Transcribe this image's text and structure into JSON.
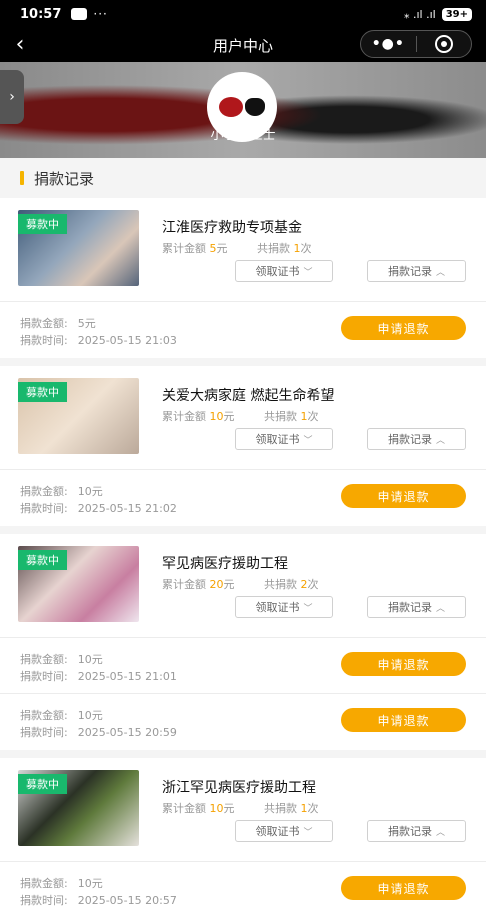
{
  "status_bar": {
    "time": "10:57",
    "dots": "···",
    "signal": "⁎ .ıl .ıl",
    "battery": "39+"
  },
  "nav": {
    "back_glyph": "‹",
    "title": "用户中心",
    "more_glyph": "•●•"
  },
  "profile": {
    "side_tab_glyph": "›",
    "username": "小小怪上士"
  },
  "section": {
    "title": "捐款记录"
  },
  "labels": {
    "status_badge": "募款中",
    "total_amount": "累计金额",
    "total_count": "共捐款",
    "cert_button": "领取证书",
    "record_button": "捐款记录",
    "donation_amount": "捐款金额:",
    "donation_time": "捐款时间:",
    "refund_button": "申请退款"
  },
  "projects": [
    {
      "title": "江淮医疗救助专项基金",
      "total": "5",
      "unit": "元",
      "count": "1",
      "count_unit": "次",
      "records": [
        {
          "amount": "5元",
          "time": "2025-05-15 21:03"
        }
      ]
    },
    {
      "title": "关爱大病家庭 燃起生命希望",
      "total": "10",
      "unit": "元",
      "count": "1",
      "count_unit": "次",
      "records": [
        {
          "amount": "10元",
          "time": "2025-05-15 21:02"
        }
      ]
    },
    {
      "title": "罕见病医疗援助工程",
      "total": "20",
      "unit": "元",
      "count": "2",
      "count_unit": "次",
      "records": [
        {
          "amount": "10元",
          "time": "2025-05-15 21:01"
        },
        {
          "amount": "10元",
          "time": "2025-05-15 20:59"
        }
      ]
    },
    {
      "title": "浙江罕见病医疗援助工程",
      "total": "10",
      "unit": "元",
      "count": "1",
      "count_unit": "次",
      "records": [
        {
          "amount": "10元",
          "time": "2025-05-15 20:57"
        }
      ]
    }
  ]
}
